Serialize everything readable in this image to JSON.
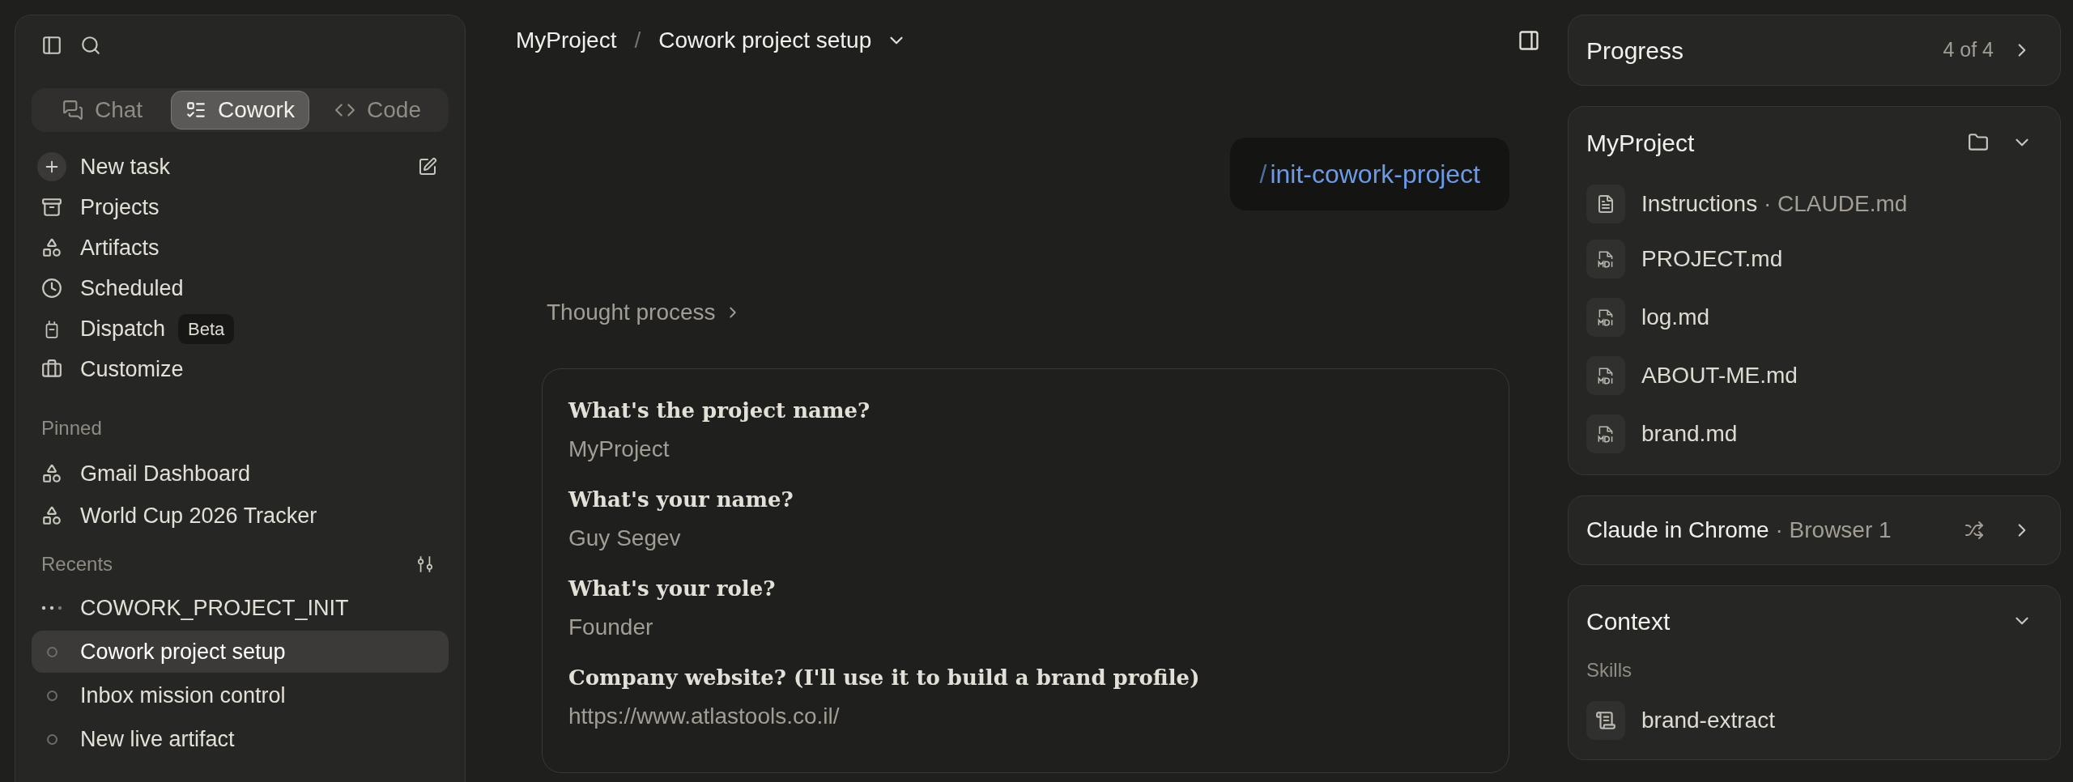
{
  "sidebar": {
    "tabs": [
      {
        "label": "Chat",
        "selected": false
      },
      {
        "label": "Cowork",
        "selected": true
      },
      {
        "label": "Code",
        "selected": false
      }
    ],
    "nav": [
      {
        "label": "New task",
        "kind": "new"
      },
      {
        "label": "Projects",
        "kind": "projects"
      },
      {
        "label": "Artifacts",
        "kind": "artifacts"
      },
      {
        "label": "Scheduled",
        "kind": "scheduled"
      },
      {
        "label": "Dispatch",
        "kind": "dispatch",
        "badge": "Beta"
      },
      {
        "label": "Customize",
        "kind": "customize"
      }
    ],
    "pinned": {
      "title": "Pinned",
      "items": [
        "Gmail Dashboard",
        "World Cup 2026 Tracker"
      ]
    },
    "recents": {
      "title": "Recents",
      "items": [
        {
          "label": "COWORK_PROJECT_INIT",
          "kind": "running",
          "selected": false
        },
        {
          "label": "Cowork project setup",
          "kind": "idle",
          "selected": true
        },
        {
          "label": "Inbox mission control",
          "kind": "idle",
          "selected": false
        },
        {
          "label": "New live artifact",
          "kind": "idle",
          "selected": false
        }
      ]
    }
  },
  "header": {
    "breadcrumb": [
      "MyProject",
      "Cowork project setup"
    ],
    "separator": "/"
  },
  "command": {
    "prefix": "/",
    "name": "init-cowork-project"
  },
  "thought": {
    "label": "Thought process",
    "expanded": false
  },
  "answers": [
    {
      "question": "What's the project name?",
      "answer": "MyProject"
    },
    {
      "question": "What's your name?",
      "answer": "Guy Segev"
    },
    {
      "question": "What's your role?",
      "answer": "Founder"
    },
    {
      "question": "Company website? (I'll use it to build a brand profile)",
      "answer": "https://www.atlastools.co.il/"
    }
  ],
  "right": {
    "progress": {
      "title": "Progress",
      "count": "4 of 4"
    },
    "project": {
      "title": "MyProject",
      "expanded": true,
      "files": [
        {
          "name": "Instructions",
          "separator": "·",
          "detail": "CLAUDE.md",
          "kind": "instructions"
        },
        {
          "name": "PROJECT.md",
          "kind": "markdown"
        },
        {
          "name": "log.md",
          "kind": "markdown"
        },
        {
          "name": "ABOUT-ME.md",
          "kind": "markdown"
        },
        {
          "name": "brand.md",
          "kind": "markdown"
        }
      ]
    },
    "browser": {
      "title": "Claude in Chrome",
      "separator": "·",
      "detail": "Browser 1"
    },
    "context": {
      "title": "Context",
      "expanded": true,
      "section": "Skills",
      "skills": [
        "brand-extract"
      ]
    }
  }
}
